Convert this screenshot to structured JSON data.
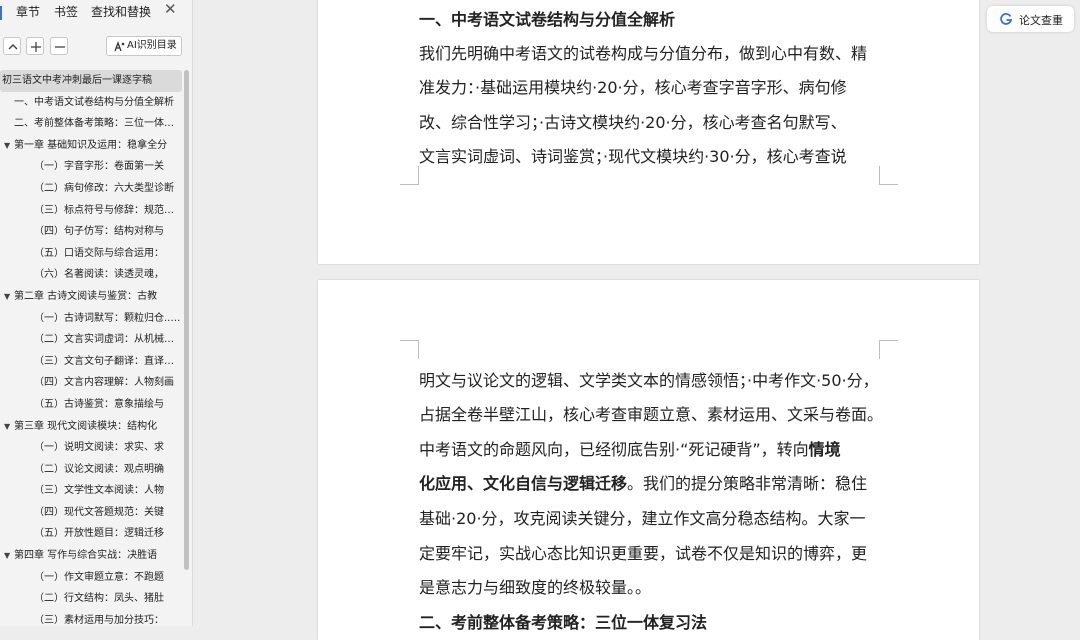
{
  "sidebar": {
    "tabs": [
      "章节",
      "书签",
      "查找和替换"
    ],
    "close_label": "✕",
    "ai_button_label": "AI识别目录",
    "toc": [
      {
        "label": "初三语文中考冲刺最后一课逐字稿",
        "indent": 0,
        "selected": true
      },
      {
        "label": "一、中考语文试卷结构与分值全解析",
        "indent": 1
      },
      {
        "label": "二、考前整体备考策略：三位一体复习法",
        "indent": 1
      },
      {
        "label": "第一章 基础知识及运用：稳拿全分",
        "indent": 1,
        "expandable": true
      },
      {
        "label": "（一）字音字形：卷面第一关",
        "indent": 2
      },
      {
        "label": "（二）病句修改：六大类型诊断",
        "indent": 2
      },
      {
        "label": "（三）标点符号与修辞：规范使用",
        "indent": 2
      },
      {
        "label": "（四）句子仿写：结构对称与",
        "indent": 2
      },
      {
        "label": "（五）口语交际与综合运用：",
        "indent": 2
      },
      {
        "label": "（六）名著阅读：读透灵魂，",
        "indent": 2
      },
      {
        "label": "第二章 古诗文阅读与鉴赏：古教",
        "indent": 1,
        "expandable": true
      },
      {
        "label": "（一）古诗词默写：颗粒归仓......",
        "indent": 2
      },
      {
        "label": "（二）文言实词虚词：从机械记忆",
        "indent": 2
      },
      {
        "label": "（三）文言文句子翻译：直译为主",
        "indent": 2
      },
      {
        "label": "（四）文言内容理解：人物刻画",
        "indent": 2
      },
      {
        "label": "（五）古诗鉴赏：意象描绘与",
        "indent": 2
      },
      {
        "label": "第三章 现代文阅读模块：结构化",
        "indent": 1,
        "expandable": true
      },
      {
        "label": "（一）说明文阅读：求实、求",
        "indent": 2
      },
      {
        "label": "（二）议论文阅读：观点明确",
        "indent": 2
      },
      {
        "label": "（三）文学性文本阅读：人物",
        "indent": 2
      },
      {
        "label": "（四）现代文答题规范：关键",
        "indent": 2
      },
      {
        "label": "（五）开放性题目：逻辑迁移",
        "indent": 2
      },
      {
        "label": "第四章 写作与综合实战：决胜语",
        "indent": 1,
        "expandable": true
      },
      {
        "label": "（一）作文审题立意：不跑题",
        "indent": 2
      },
      {
        "label": "（二）行文结构：凤头、猪肚",
        "indent": 2
      },
      {
        "label": "（三）素材运用与加分技巧：",
        "indent": 2
      }
    ]
  },
  "right_button_label": "论文查重",
  "document": {
    "page1_lines": [
      {
        "text": "一、中考语文试卷结构与分值全解析",
        "heading": true
      },
      {
        "text": "我们先明确中考语文的试卷构成与分值分布，做到心中有数、精"
      },
      {
        "text": "准发力：·基础运用模块约·20·分，核心考查字音字形、病句修"
      },
      {
        "text": "改、综合性学习；·古诗文模块约·20·分，核心考查名句默写、"
      },
      {
        "text": "文言实词虚词、诗词鉴赏；·现代文模块约·30·分，核心考查说"
      }
    ],
    "page2_lines": [
      {
        "text": "明文与议论文的逻辑、文学类文本的情感领悟；·中考作文·50·分，"
      },
      {
        "text": "占据全卷半壁江山，核心考查审题立意、素材运用、文采与卷面。"
      },
      {
        "text": "中考语文的命题风向，已经彻底告别·“死记硬背”，转向",
        "bold_tail": "情境"
      },
      {
        "bold_head": "化应用、文化自信与逻辑迁移",
        "text": "。我们的提分策略非常清晰：稳住"
      },
      {
        "text": "基础·20·分，攻克阅读关键分，建立作文高分稳态结构。大家一"
      },
      {
        "text": "定要牢记，实战心态比知识更重要，试卷不仅是知识的博弈，更"
      },
      {
        "text": "是意志力与细致度的终极较量。。"
      },
      {
        "text": "二、考前整体备考策略：三位一体复习法",
        "heading": true
      }
    ]
  }
}
